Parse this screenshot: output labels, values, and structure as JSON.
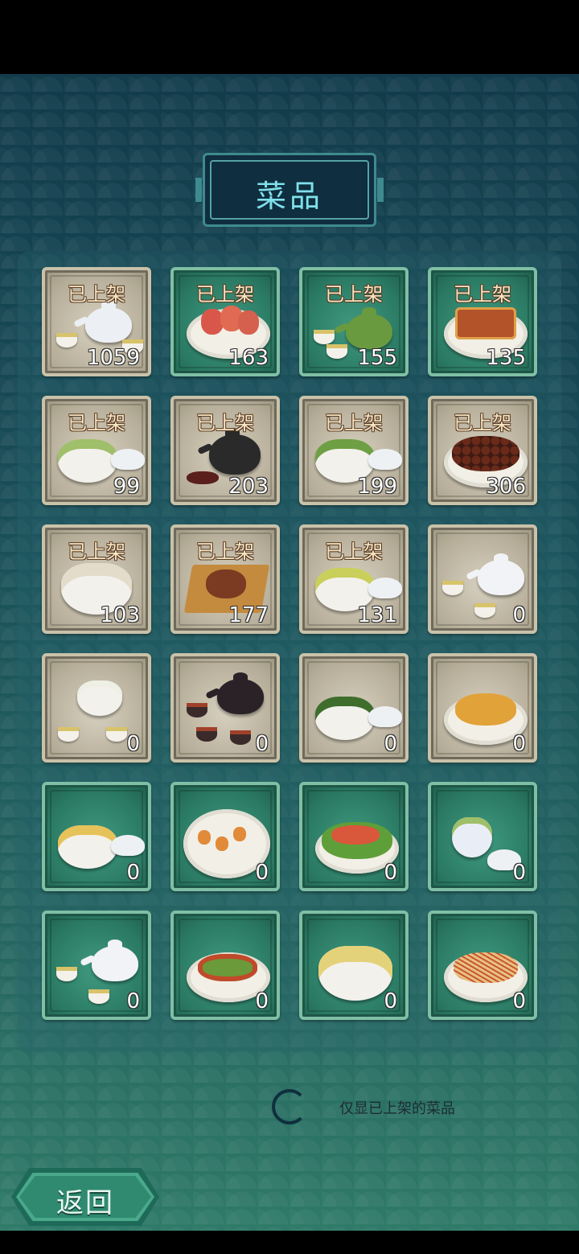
{
  "page_title": "菜品",
  "dishes": [
    {
      "status": "已上架",
      "count": "1059",
      "style": "stone",
      "icon": "teapot-white-icon"
    },
    {
      "status": "已上架",
      "count": "163",
      "style": "jade",
      "icon": "pastry-plate-icon"
    },
    {
      "status": "已上架",
      "count": "155",
      "style": "jade",
      "icon": "green-teapot-icon"
    },
    {
      "status": "已上架",
      "count": "135",
      "style": "jade",
      "icon": "fried-tofu-plate-icon"
    },
    {
      "status": "已上架",
      "count": "99",
      "style": "stone",
      "icon": "green-tea-bowl-icon"
    },
    {
      "status": "已上架",
      "count": "203",
      "style": "stone",
      "icon": "iron-kettle-icon"
    },
    {
      "status": "已上架",
      "count": "199",
      "style": "stone",
      "icon": "blue-tea-bowl-icon"
    },
    {
      "status": "已上架",
      "count": "306",
      "style": "stone",
      "icon": "braised-beans-plate-icon"
    },
    {
      "status": "已上架",
      "count": "103",
      "style": "stone",
      "icon": "soy-milk-bowl-icon"
    },
    {
      "status": "已上架",
      "count": "177",
      "style": "stone",
      "icon": "steamed-dish-tray-icon"
    },
    {
      "status": "已上架",
      "count": "131",
      "style": "stone",
      "icon": "yellow-tea-bowl-icon"
    },
    {
      "status": "",
      "count": "0",
      "style": "stone",
      "icon": "white-teaset-icon"
    },
    {
      "status": "",
      "count": "0",
      "style": "stone",
      "icon": "gaiwan-cups-icon"
    },
    {
      "status": "",
      "count": "0",
      "style": "stone",
      "icon": "black-teaset-icon"
    },
    {
      "status": "",
      "count": "0",
      "style": "stone",
      "icon": "green-tea-gaiwan-icon"
    },
    {
      "status": "",
      "count": "0",
      "style": "stone",
      "icon": "fried-chicken-plate-icon"
    },
    {
      "status": "",
      "count": "0",
      "style": "jade",
      "icon": "lemon-tea-bowl-icon"
    },
    {
      "status": "",
      "count": "0",
      "style": "jade",
      "icon": "lantern-dessert-plate-icon"
    },
    {
      "status": "",
      "count": "0",
      "style": "jade",
      "icon": "shrimp-lotus-plate-icon"
    },
    {
      "status": "",
      "count": "0",
      "style": "jade",
      "icon": "blue-white-tea-cup-icon"
    },
    {
      "status": "",
      "count": "0",
      "style": "jade",
      "icon": "jade-teaset-icon"
    },
    {
      "status": "",
      "count": "0",
      "style": "jade",
      "icon": "stir-fry-plate-icon"
    },
    {
      "status": "",
      "count": "0",
      "style": "jade",
      "icon": "tofu-soup-bowl-icon"
    },
    {
      "status": "",
      "count": "0",
      "style": "jade",
      "icon": "shredded-potato-plate-icon"
    }
  ],
  "filter": {
    "label": "仅显已上架的菜品"
  },
  "back_button": {
    "label": "返回"
  }
}
